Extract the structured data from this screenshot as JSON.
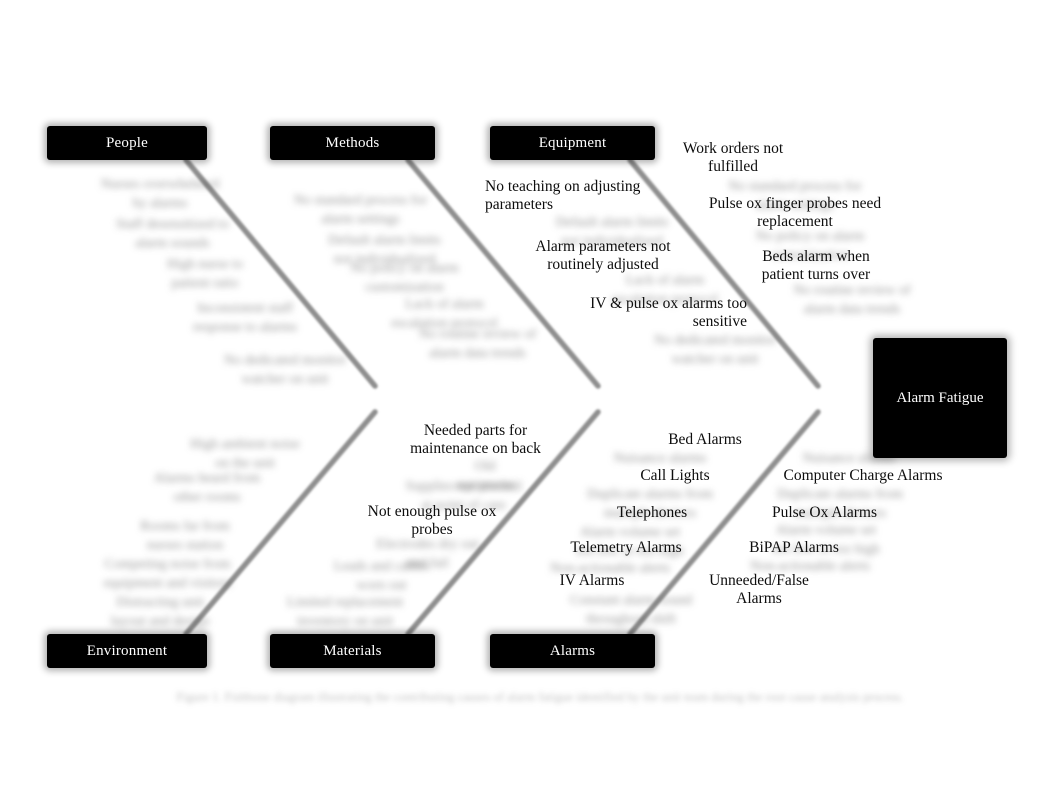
{
  "diagram": {
    "type": "fishbone-ishikawa",
    "effect": "Alarm Fatigue",
    "background_color": "#ffffff",
    "box_color": "#000000",
    "box_text_color": "#ffffff",
    "spine_color": "#000000",
    "branch_color": "#8c8c8c"
  },
  "categories": {
    "top": [
      {
        "label": "People"
      },
      {
        "label": "Methods"
      },
      {
        "label": "Equipment"
      }
    ],
    "bottom": [
      {
        "label": "Environment"
      },
      {
        "label": "Materials"
      },
      {
        "label": "Alarms"
      }
    ]
  },
  "causes": {
    "equipment": [
      {
        "text": "No teaching on adjusting\nparameters"
      },
      {
        "text": "Alarm parameters not\nroutinely adjusted"
      },
      {
        "text": "IV & pulse ox alarms too\nsensitive"
      },
      {
        "text": "Work orders not\nfulfilled"
      },
      {
        "text": "Pulse ox finger probes need\nreplacement"
      },
      {
        "text": "Beds alarm when\npatient turns over"
      }
    ],
    "materials": [
      {
        "text": "Needed parts for\nmaintenance on back"
      },
      {
        "text": "Not enough pulse ox\nprobes"
      }
    ],
    "alarms": [
      {
        "text": "Bed Alarms"
      },
      {
        "text": "Call Lights"
      },
      {
        "text": "Telephones"
      },
      {
        "text": "Telemetry Alarms"
      },
      {
        "text": "IV Alarms"
      },
      {
        "text": "Computer Charge Alarms"
      },
      {
        "text": "Pulse Ox Alarms"
      },
      {
        "text": "BiPAP Alarms"
      },
      {
        "text": "Unneeded/False\nAlarms"
      }
    ],
    "people_illegible": [
      {
        "text": "Nurses overwhelmed\nby alarms"
      },
      {
        "text": "Staff desensitized to\nalarm sounds"
      },
      {
        "text": "High nurse to\npatient ratio"
      },
      {
        "text": "Inconsistent staff\nresponse to alarms"
      },
      {
        "text": "No dedicated monitor\nwatcher on unit"
      }
    ],
    "methods_illegible": [
      {
        "text": "No standard process for\nalarm settings"
      },
      {
        "text": "Default alarm limits\nnot individualized"
      },
      {
        "text": "No policy on alarm\ncustomization"
      },
      {
        "text": "Lack of alarm\nescalation protocol"
      },
      {
        "text": "No routine review of\nalarm data trends"
      }
    ],
    "environment_illegible": [
      {
        "text": "High ambient noise\non the unit"
      },
      {
        "text": "Alarms heard from\nother rooms"
      },
      {
        "text": "Rooms far from\nnurses station"
      },
      {
        "text": "Competing noise from\nequipment and visitors"
      },
      {
        "text": "Distracting unit\nlayout and design"
      }
    ],
    "materials_illegible": [
      {
        "text": "Old\nequipment"
      },
      {
        "text": "Supplies not stocked\nat point of care"
      },
      {
        "text": "Electrodes dry out\nand fail"
      },
      {
        "text": "Leads and cables\nworn out"
      },
      {
        "text": "Limited replacement\ninventory on unit"
      }
    ],
    "alarms_illegible": [
      {
        "text": "Nuisance alarms"
      },
      {
        "text": "Duplicate alarms from\nmultiple devices"
      },
      {
        "text": "Alarm volume set\ntoo low or too high"
      },
      {
        "text": "Non-actionable alerts"
      },
      {
        "text": "Constant alarm sound\nthroughout shift"
      }
    ]
  },
  "footer": {
    "caption": "Figure 1. Fishbone diagram illustrating the contributing causes of alarm fatigue identified by the unit team during the root cause analysis process.",
    "legible": false
  }
}
